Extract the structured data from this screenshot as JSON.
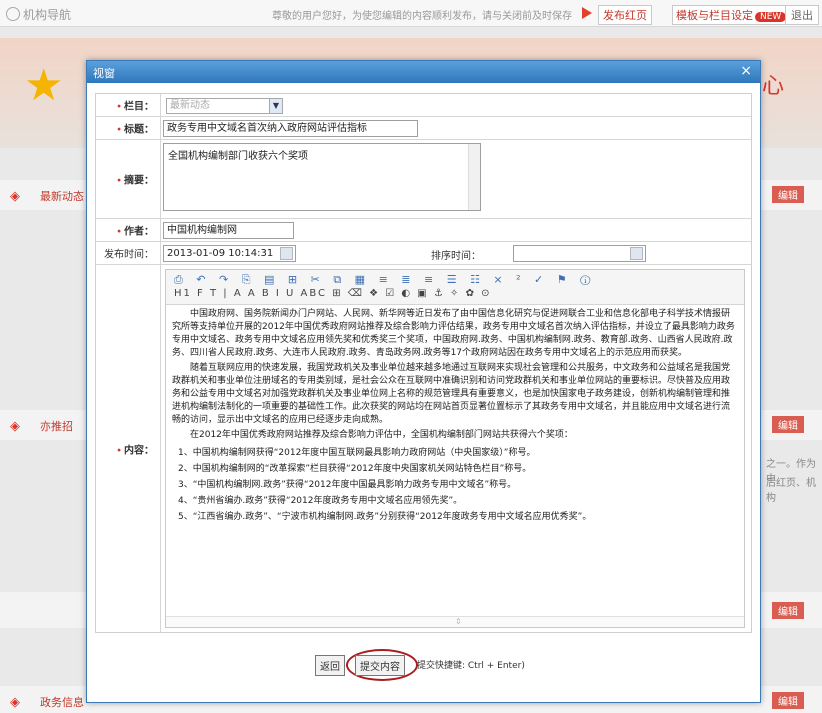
{
  "topbar": {
    "home_label": "机构导航",
    "notice": "尊敬的用户您好，为使您编辑的内容顺利发布，请与关闭前及时保存",
    "publish_button": "发布红页",
    "template_button": "模板与栏目设定",
    "template_badge": "NEW",
    "logout_button": "退出"
  },
  "background": {
    "banner_char": "心",
    "sections": [
      "最新动态",
      "亦推招",
      "",
      "政务信息"
    ],
    "edit_label": "编辑",
    "side_snippet_1": "之一。作为中",
    "side_snippet_2": "后红页、机构"
  },
  "dialog": {
    "title": "视窗",
    "close": "×",
    "labels": {
      "column": "栏目：",
      "title": "标题：",
      "summary": "摘要：",
      "author": "作者：",
      "publish_time": "发布时间：",
      "sort_time": "排序时间：",
      "content": "内容："
    },
    "column_value": "最新动态",
    "title_value": "政务专用中文域名首次纳入政府网站评估指标",
    "summary_value": "全国机构编制部门收获六个奖项",
    "author_value": "中国机构编制网",
    "publish_time_value": "2013-01-09 10:14:31",
    "sort_time_value": "",
    "toolbar": {
      "row1": "⎙ ↶ ↷ ⎘ ▤ ⊞ ✂ ⧉ ▦ ≡ ≣ ≡ ☰ ☷ × ² ✓ ⚑ ⓘ",
      "row2": "H1 F T | A A B I U ABC ⊞ ⌫ ❖ ☑ ◐ ▣ ⚓ ✧ ✿ ⊙"
    },
    "content_paragraphs": [
      "中国政府网、国务院新闻办门户网站、人民网、新华网等近日发布了由中国信息化研究与促进网联合工业和信息化部电子科学技术情报研究所等支持单位开展的2012年中国优秀政府网站推荐及综合影响力评估结果，政务专用中文域名首次纳入评估指标，并设立了最具影响力政务专用中文域名、政务专用中文域名应用领先奖和优秀奖三个奖项，中国政府网.政务、中国机构编制网.政务、教育部.政务、山西省人民政府.政务、四川省人民政府.政务、大连市人民政府.政务、青岛政务网.政务等17个政府网站因在政务专用中文域名上的示范应用而获奖。",
      "随着互联网应用的快速发展，我国党政机关及事业单位越来越多地通过互联网来实现社会管理和公共服务，中文政务和公益域名是我国党政群机关和事业单位注册域名的专用类别域，是社会公众在互联网中准确识别和访问党政群机关和事业单位网站的重要标识。尽快普及应用政务和公益专用中文域名对加强党政群机关及事业单位网上名称的规范管理具有重要意义，也是加快国家电子政务建设，创新机构编制管理和推进机构编制法制化的一项重要的基础性工作。此次获奖的网站均在网站首页显著位置标示了其政务专用中文域名，并且能应用中文域名进行流畅的访问，显示出中文域名的应用已经逐步走向成熟。",
      "在2012年中国优秀政府网站推荐及综合影响力评估中，全国机构编制部门网站共获得六个奖项："
    ],
    "content_list": [
      "1、中国机构编制网获得“2012年度中国互联网最具影响力政府网站（中央国家级）”称号。",
      "2、中国机构编制网的“改革探索”栏目获得“2012年度中央国家机关网站特色栏目”称号。",
      "3、“中国机构编制网.政务”获得“2012年度中国最具影响力政务专用中文域名”称号。",
      "4、“贵州省编办.政务”获得“2012年度政务专用中文域名应用领先奖”。",
      "5、“江西省编办.政务”、“宁波市机构编制网.政务”分别获得“2012年度政务专用中文域名应用优秀奖”。"
    ],
    "back_button": "返回",
    "submit_button": "提交内容",
    "submit_hint": "提交快捷键: Ctrl + Enter)"
  }
}
